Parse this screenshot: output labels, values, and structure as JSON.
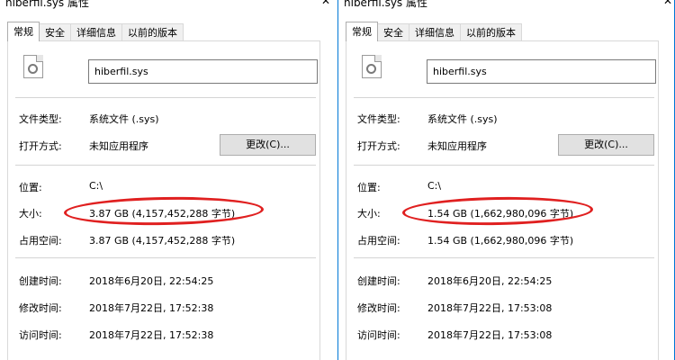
{
  "windows": [
    {
      "title": "hiberfil.sys 属性",
      "close_glyph": "✕",
      "tabs": [
        "常规",
        "安全",
        "详细信息",
        "以前的版本"
      ],
      "filename": "hiberfil.sys",
      "file_type_label": "文件类型:",
      "file_type_value": "系统文件 (.sys)",
      "open_with_label": "打开方式:",
      "open_with_value": "未知应用程序",
      "change_button": "更改(C)...",
      "location_label": "位置:",
      "location_value": "C:\\",
      "size_label": "大小:",
      "size_value": "3.87 GB (4,157,452,288 字节)",
      "size_on_disk_label": "占用空间:",
      "size_on_disk_value": "3.87 GB (4,157,452,288 字节)",
      "created_label": "创建时间:",
      "created_value": "2018年6月20日, 22:54:25",
      "modified_label": "修改时间:",
      "modified_value": "2018年7月22日, 17:52:38",
      "accessed_label": "访问时间:",
      "accessed_value": "2018年7月22日, 17:52:38"
    },
    {
      "title": "hiberfil.sys 属性",
      "close_glyph": "✕",
      "tabs": [
        "常规",
        "安全",
        "详细信息",
        "以前的版本"
      ],
      "filename": "hiberfil.sys",
      "file_type_label": "文件类型:",
      "file_type_value": "系统文件 (.sys)",
      "open_with_label": "打开方式:",
      "open_with_value": "未知应用程序",
      "change_button": "更改(C)...",
      "location_label": "位置:",
      "location_value": "C:\\",
      "size_label": "大小:",
      "size_value": "1.54 GB (1,662,980,096 字节)",
      "size_on_disk_label": "占用空间:",
      "size_on_disk_value": "1.54 GB (1,662,980,096 字节)",
      "created_label": "创建时间:",
      "created_value": "2018年6月20日, 22:54:25",
      "modified_label": "修改时间:",
      "modified_value": "2018年7月22日, 17:53:08",
      "accessed_label": "访问时间:",
      "accessed_value": "2018年7月22日, 17:53:08"
    }
  ],
  "colors": {
    "window_border": "#0078d7",
    "highlight_oval": "#e02020",
    "button_bg": "#e1e1e1"
  }
}
